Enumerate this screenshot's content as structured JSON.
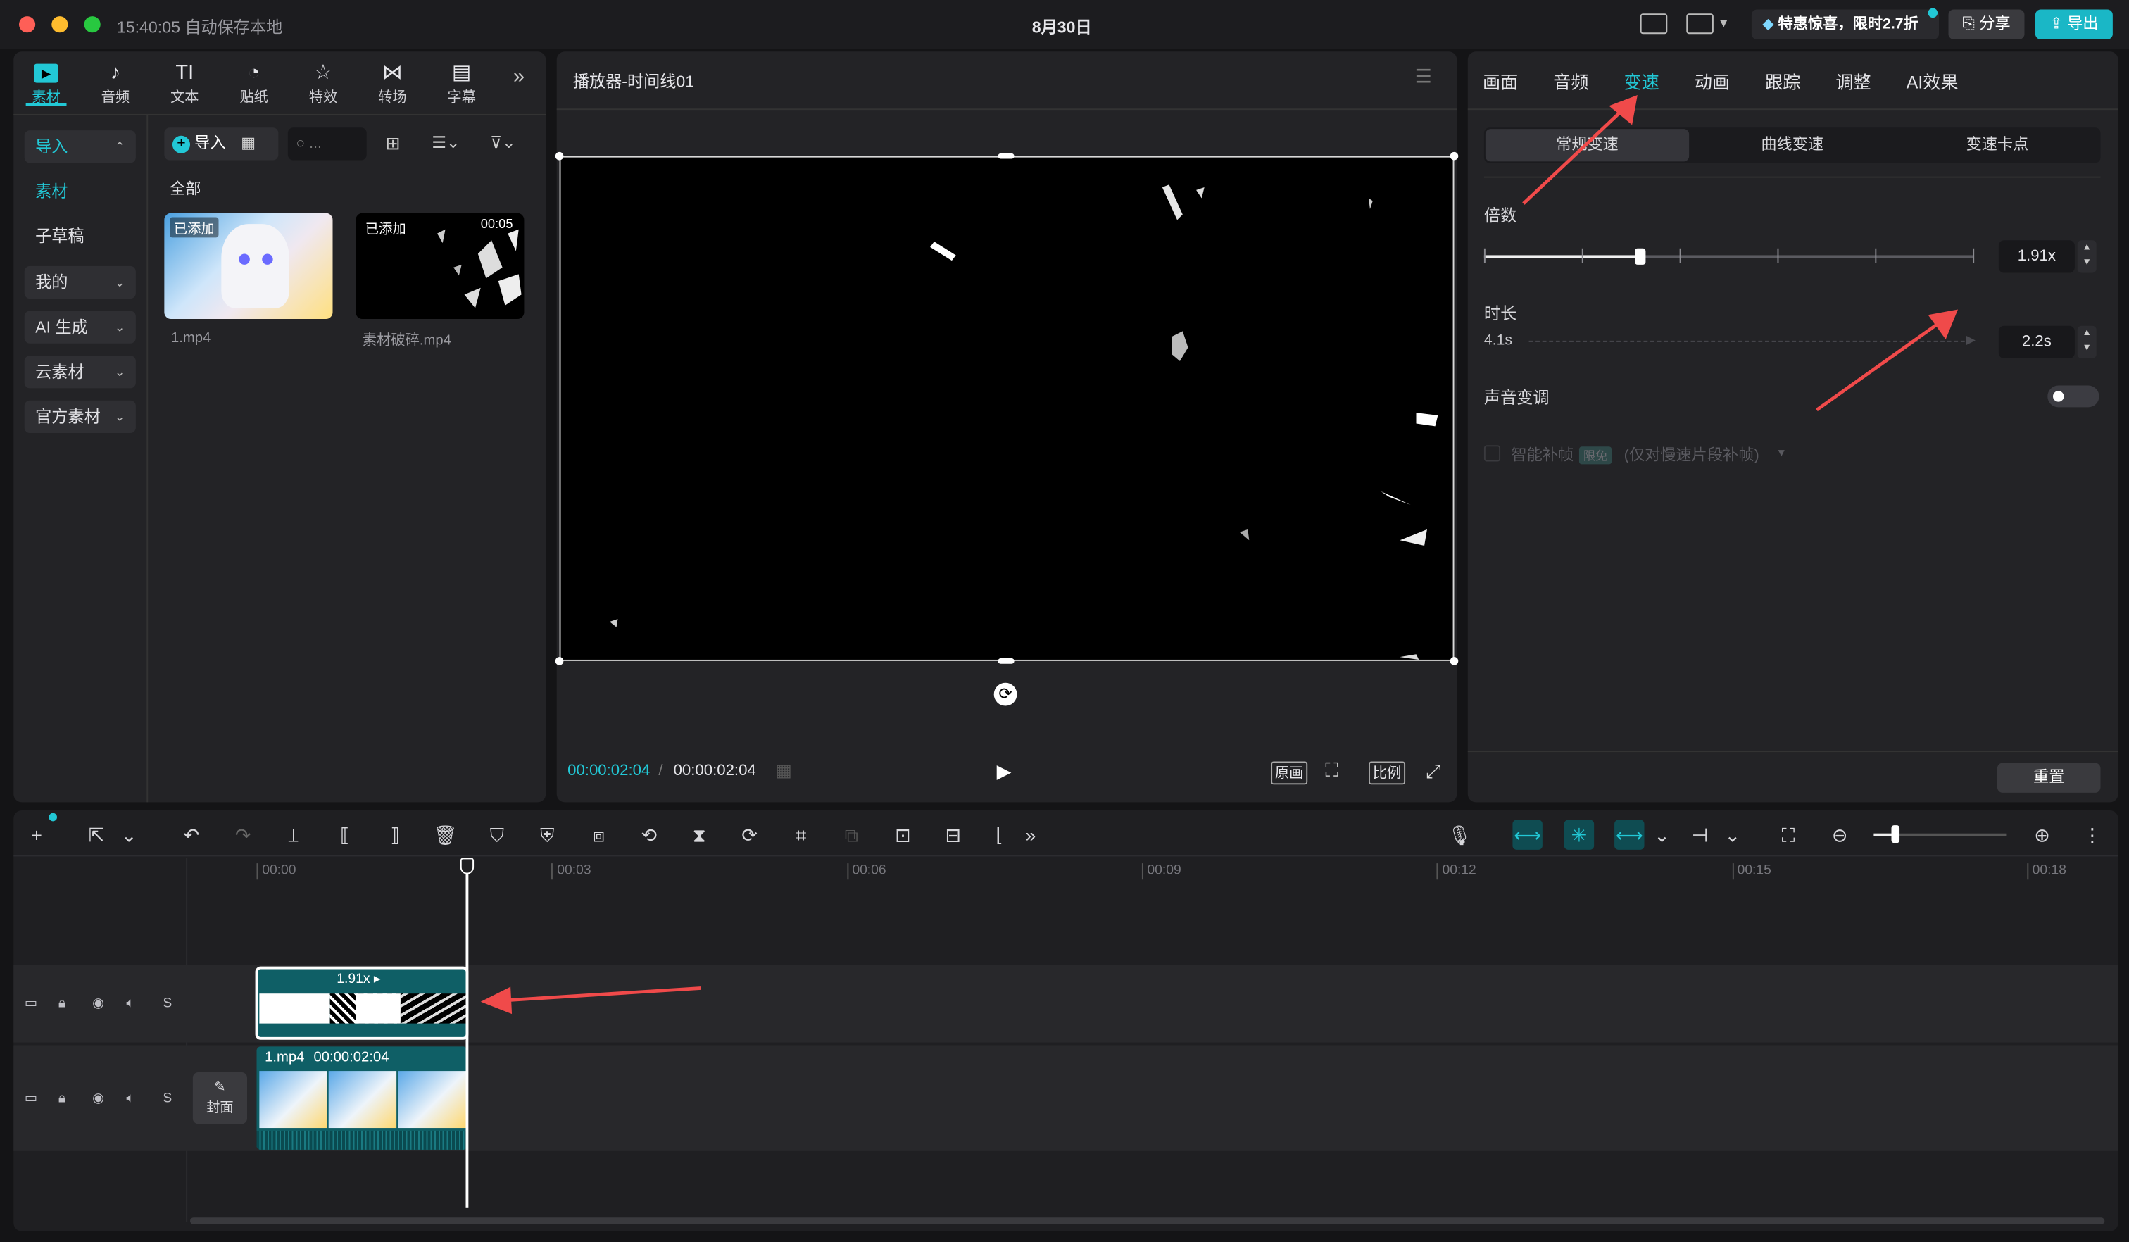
{
  "titlebar": {
    "autosave": "15:40:05 自动保存本地",
    "project_title": "8月30日",
    "promo": "特惠惊喜，限时2.7折",
    "share": "分享",
    "export": "导出"
  },
  "toolbar": [
    {
      "label": "素材",
      "icon": "media-icon"
    },
    {
      "label": "音频",
      "icon": "audio-icon"
    },
    {
      "label": "文本",
      "icon": "text-icon"
    },
    {
      "label": "贴纸",
      "icon": "sticker-icon"
    },
    {
      "label": "特效",
      "icon": "effects-icon"
    },
    {
      "label": "转场",
      "icon": "transition-icon"
    },
    {
      "label": "字幕",
      "icon": "subtitle-icon"
    }
  ],
  "sidebar": {
    "import": "导入",
    "media": "素材",
    "draft": "子草稿",
    "mine": "我的",
    "ai": "AI 生成",
    "cloud": "云素材",
    "official": "官方素材"
  },
  "media_panel": {
    "import_button": "导入",
    "search_placeholder": "...",
    "all_label": "全部",
    "items": [
      {
        "name": "1.mp4",
        "badge": "已添加"
      },
      {
        "name": "素材破碎.mp4",
        "badge": "已添加",
        "duration": "00:05"
      }
    ]
  },
  "player": {
    "title": "播放器-时间线01",
    "current_time": "00:00:02:04",
    "separator": "/",
    "total_time": "00:00:02:04",
    "original_btn": "原画",
    "ratio_btn": "比例"
  },
  "inspector": {
    "tabs": [
      "画面",
      "音频",
      "变速",
      "动画",
      "跟踪",
      "调整",
      "AI效果"
    ],
    "active_tab": "变速",
    "segments": [
      "常规变速",
      "曲线变速",
      "变速卡点"
    ],
    "multiplier_label": "倍数",
    "multiplier_value": "1.91x",
    "speed_fraction": 0.32,
    "duration_label": "时长",
    "duration_original": "4.1s",
    "duration_value": "2.2s",
    "pitch_label": "声音变调",
    "smart_fill": "智能补帧",
    "smart_fill_badge": "限免",
    "smart_fill_note": "(仅对慢速片段补帧)",
    "reset": "重置"
  },
  "timeline": {
    "ruler": [
      "00:00",
      "00:03",
      "00:06",
      "00:09",
      "00:12",
      "00:15",
      "00:18"
    ],
    "clip1_speed": "1.91x",
    "clip2_name": "1.mp4",
    "clip2_duration": "00:00:02:04",
    "cover_label": "封面",
    "solo": "S"
  },
  "colors": {
    "accent": "#22c8d6",
    "panel": "#232326",
    "background": "#141416",
    "arrow": "#f04a4a",
    "clip": "#0f5f66"
  }
}
